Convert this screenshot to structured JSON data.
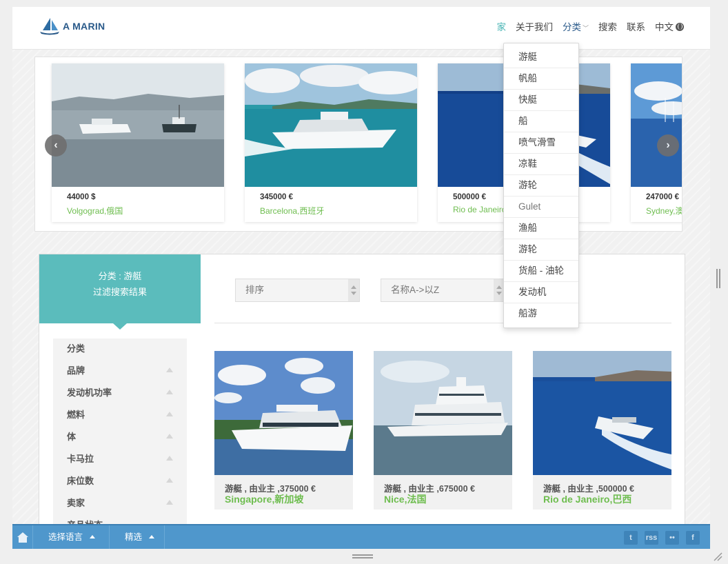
{
  "brand": {
    "name": "A MARIN"
  },
  "nav": {
    "home": "家",
    "about": "关于我们",
    "categories": "分类",
    "search": "搜索",
    "contact": "联系",
    "language": "中文"
  },
  "categories_menu": [
    "游艇",
    "帆船",
    "快艇",
    "船",
    "喷气滑雪",
    "凉鞋",
    "游轮",
    "Gulet",
    "渔船",
    "游轮",
    "货船 - 油轮",
    "发动机",
    "船游"
  ],
  "carousel": {
    "items": [
      {
        "price": "44000 $",
        "location": "Volgograd,俄国"
      },
      {
        "price": "345000 €",
        "location": "Barcelona,西班牙"
      },
      {
        "price": "500000 €",
        "location": "Rio de Janeiro"
      },
      {
        "price": "247000 €",
        "location": "Sydney,澳"
      }
    ]
  },
  "sidebar": {
    "heading_line1": "分类 : 游艇",
    "heading_line2": "过滤搜索结果",
    "filters": [
      "分类",
      "品牌",
      "发动机功率",
      "燃料",
      "体",
      "卡马拉",
      "床位数",
      "卖家",
      "产品状态"
    ]
  },
  "sort": {
    "sort_label": "排序",
    "order_label": "名称A->以Z"
  },
  "listings": [
    {
      "title": "游艇 , 由业主 ,375000 €",
      "location": "Singapore,新加坡"
    },
    {
      "title": "游艇 , 由业主 ,675000 €",
      "location": "Nice,法国"
    },
    {
      "title": "游艇 , 由业主 ,500000 €",
      "location": "Rio de Janeiro,巴西"
    }
  ],
  "bottombar": {
    "language": "选择语言",
    "featured": "精选",
    "social": [
      "t",
      "rss",
      "••",
      "f"
    ]
  },
  "colors": {
    "accent": "#5bbcbc",
    "location_green": "#6ebd4f",
    "bottombar": "#4f97cc",
    "brand_blue": "#2a5a8a"
  }
}
